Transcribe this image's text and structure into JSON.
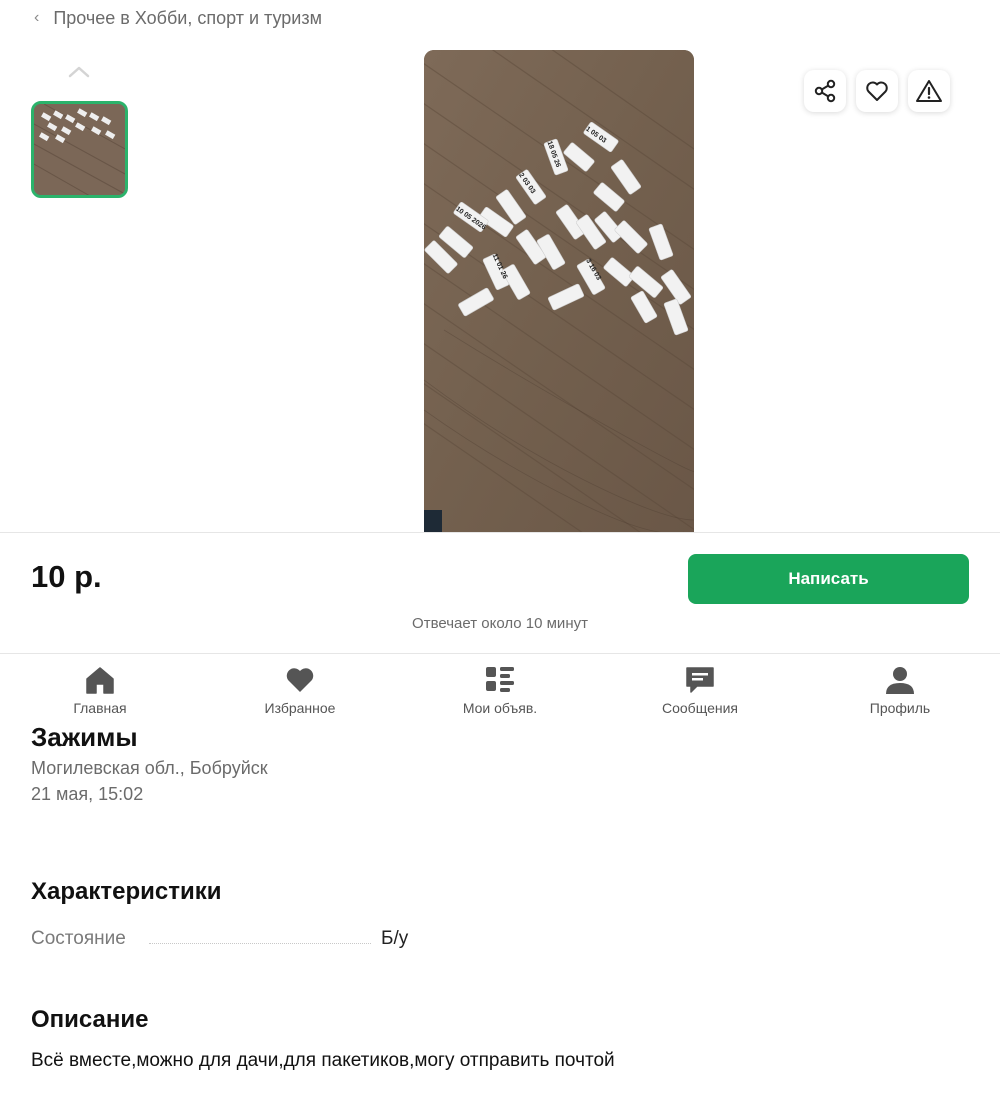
{
  "breadcrumb": {
    "label": "Прочее в Хобби, спорт и туризм"
  },
  "listing": {
    "title_partial": "Зажимы",
    "location": "Могилевская обл., Бобруйск",
    "date": "21 мая, 15:02",
    "price": "10 р.",
    "write_button": "Написать",
    "reply_time": "Отвечает около 10 минут"
  },
  "nav": {
    "items": [
      {
        "label": "Главная",
        "icon": "home-icon"
      },
      {
        "label": "Избранное",
        "icon": "heart-icon"
      },
      {
        "label": "Мои объяв.",
        "icon": "list-icon"
      },
      {
        "label": "Сообщения",
        "icon": "chat-icon"
      },
      {
        "label": "Профиль",
        "icon": "user-icon"
      }
    ]
  },
  "characteristics": {
    "heading": "Характеристики",
    "rows": [
      {
        "label": "Состояние",
        "value": "Б/у"
      }
    ]
  },
  "description": {
    "heading": "Описание",
    "text": "Всё вместе,можно для дачи,для пакетиков,могу отправить почтой"
  },
  "colors": {
    "accent": "#1aa55a",
    "thumb_border": "#2bb36b",
    "wood": "#76624f"
  }
}
